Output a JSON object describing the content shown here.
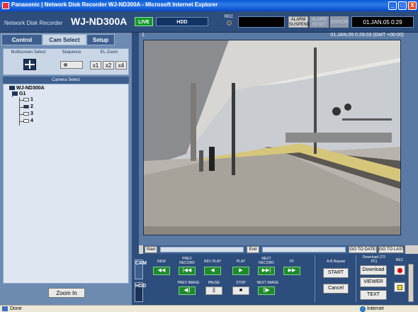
{
  "window": {
    "title": "Panasonic | Network Disk Recorder WJ-ND300A - Microsoft Internet Explorer",
    "minimize": "_",
    "maximize": "□",
    "close": "X"
  },
  "header": {
    "brand_small": "Network Disk Recorder",
    "brand_model": "WJ-ND300A",
    "live": "LIVE",
    "hdd": "HDD",
    "rec_label": "REC",
    "alarm_suspend": "ALARM SUSPEND",
    "alarm_reset": "ALARM RESET",
    "error": "ERROR",
    "clock": "01.JAN.05   0:29"
  },
  "tabs": {
    "control": "Control",
    "cam_select": "Cam Select",
    "setup": "Setup"
  },
  "cam_select": {
    "multiscreen_label": "Multiscreen Select",
    "sequence_label": "Sequence",
    "el_zoom_label": "EL-Zoom",
    "zoom_options": [
      "x1",
      "x2",
      "x4"
    ],
    "camera_select_label": "Camera Select",
    "tree": {
      "root": "WJ-ND300A",
      "group": "G1",
      "cameras": [
        "1",
        "2",
        "3",
        "4"
      ]
    },
    "zoom_in": "Zoom In"
  },
  "video": {
    "camera_number": "1",
    "timestamp": "01.JAN.05   0:29:03 (GMT +00:00)"
  },
  "seek": {
    "start": "Start",
    "end": "End",
    "go_to_date": "GO TO DATE",
    "go_to_last": "GO TO LAST"
  },
  "controls": {
    "cam_tab": "CAM",
    "hdd_tab": "HDD",
    "labels_top": [
      "REW",
      "PREV RECORD",
      "REV PLAY",
      "PLAY",
      "NEXT RECORD",
      "FF"
    ],
    "labels_bottom": [
      "PREV IMAGE",
      "PAUSE",
      "STOP",
      "NEXT IMAGE"
    ],
    "ab_repeat_label": "A-B Repeat",
    "start": "START",
    "cancel": "Cancel",
    "download_label": "Download (TO PC)",
    "download": "Download",
    "viewer": "VIEWER",
    "text": "TEXT",
    "rec_label": "REC"
  },
  "status_bar": {
    "status": "Done",
    "zone": "Internet"
  },
  "colors": {
    "header_bg": "#2d4d7c",
    "panel_bg": "#6d8bb1",
    "live_green": "#139a2a",
    "rec_red": "#d20000"
  }
}
